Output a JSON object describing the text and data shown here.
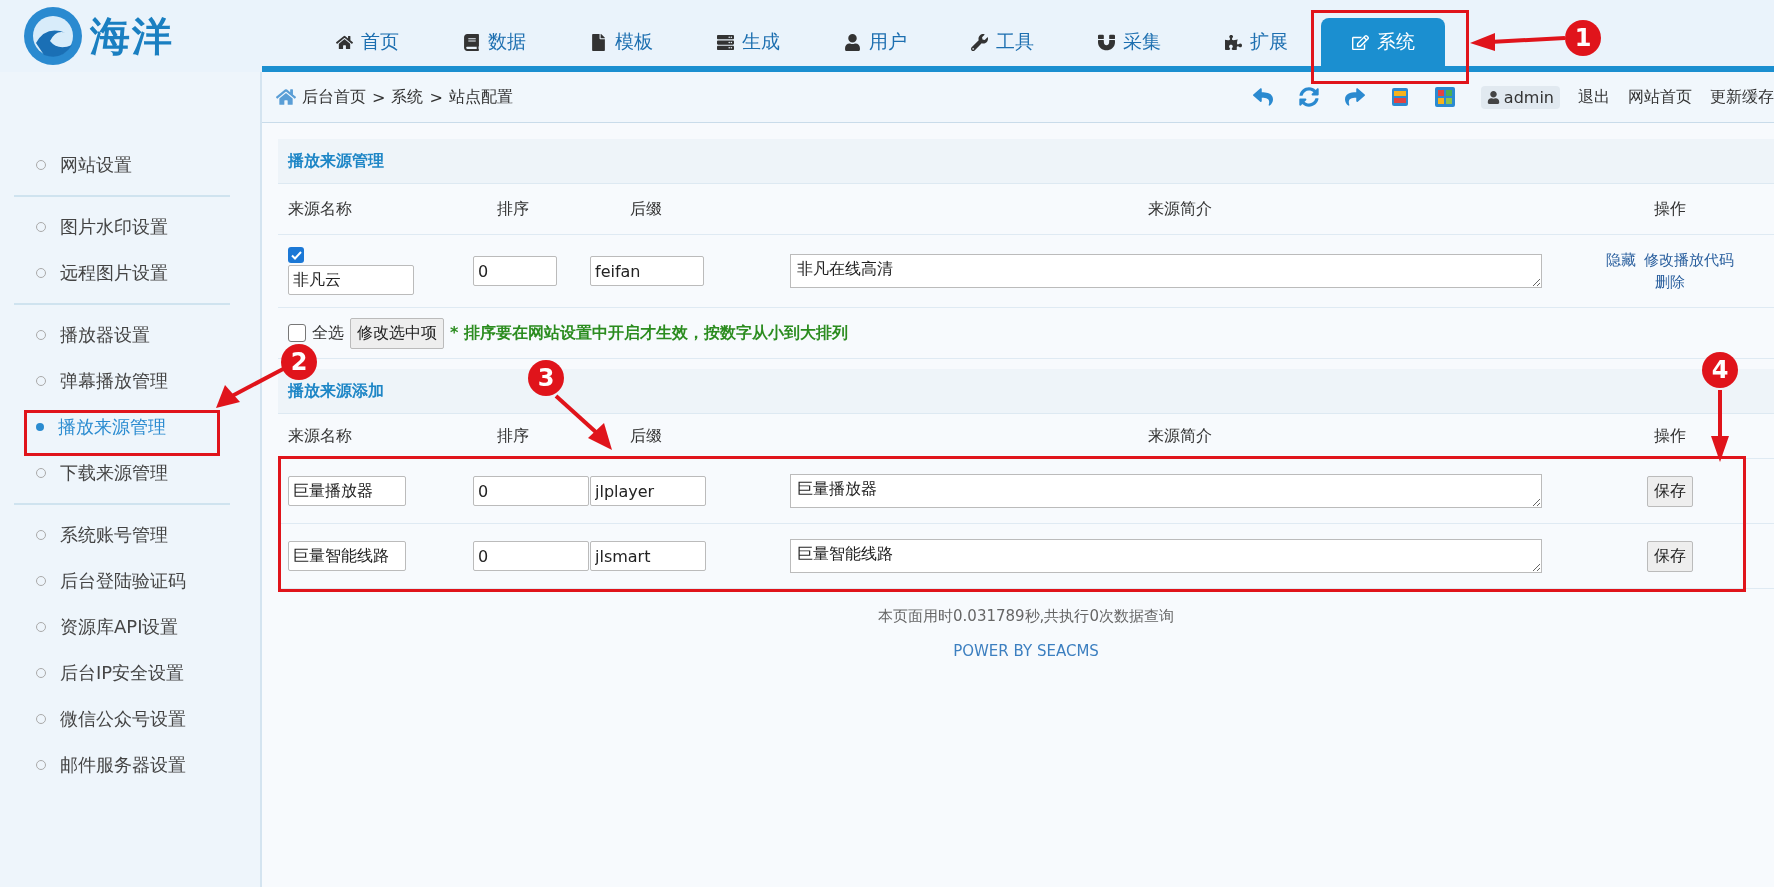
{
  "logo": {
    "text": "海洋"
  },
  "nav": [
    {
      "label": "首页",
      "selected": false
    },
    {
      "label": "数据",
      "selected": false
    },
    {
      "label": "模板",
      "selected": false
    },
    {
      "label": "生成",
      "selected": false
    },
    {
      "label": "用户",
      "selected": false
    },
    {
      "label": "工具",
      "selected": false
    },
    {
      "label": "采集",
      "selected": false
    },
    {
      "label": "扩展",
      "selected": false
    },
    {
      "label": "系统",
      "selected": true
    }
  ],
  "breadcrumb": [
    "后台首页",
    ">",
    "系统",
    ">",
    "站点配置"
  ],
  "user": {
    "name": "admin"
  },
  "header_links": [
    "退出",
    "网站首页",
    "更新缓存"
  ],
  "sidebar": [
    [
      {
        "label": "网站设置",
        "selected": false
      }
    ],
    [
      {
        "label": "图片水印设置",
        "selected": false
      },
      {
        "label": "远程图片设置",
        "selected": false
      }
    ],
    [
      {
        "label": "播放器设置",
        "selected": false
      },
      {
        "label": "弹幕播放管理",
        "selected": false
      },
      {
        "label": "播放来源管理",
        "selected": true
      },
      {
        "label": "下载来源管理",
        "selected": false
      }
    ],
    [
      {
        "label": "系统账号管理",
        "selected": false
      },
      {
        "label": "后台登陆验证码",
        "selected": false
      },
      {
        "label": "资源库API设置",
        "selected": false
      },
      {
        "label": "后台IP安全设置",
        "selected": false
      },
      {
        "label": "微信公众号设置",
        "selected": false
      },
      {
        "label": "邮件服务器设置",
        "selected": false
      }
    ]
  ],
  "manage": {
    "title": "播放来源管理",
    "columns": [
      "来源名称",
      "排序",
      "后缀",
      "来源简介",
      "操作"
    ],
    "rows": [
      {
        "checked": true,
        "name": "非凡云",
        "sort": "0",
        "suffix": "feifan",
        "description": "非凡在线高清",
        "actions": [
          "隐藏",
          "修改播放代码",
          "删除"
        ]
      }
    ],
    "select_all": {
      "label": "全选",
      "checked": false
    },
    "bulk_button": "修改选中项",
    "note": "* 排序要在网站设置中开启才生效，按数字从小到大排列"
  },
  "add": {
    "title": "播放来源添加",
    "columns": [
      "来源名称",
      "排序",
      "后缀",
      "来源简介",
      "操作"
    ],
    "rows": [
      {
        "name": "巨量播放器",
        "sort": "0",
        "suffix": "jlplayer",
        "description": "巨量播放器",
        "button": "保存"
      },
      {
        "name": "巨量智能线路",
        "sort": "0",
        "suffix": "jlsmart",
        "description": "巨量智能线路",
        "button": "保存"
      }
    ]
  },
  "footer": {
    "stats": "本页面用时0.031789秒,共执行0次数据查询",
    "power": "POWER BY SEACMS"
  },
  "annotations": [
    "1",
    "2",
    "3",
    "4"
  ]
}
